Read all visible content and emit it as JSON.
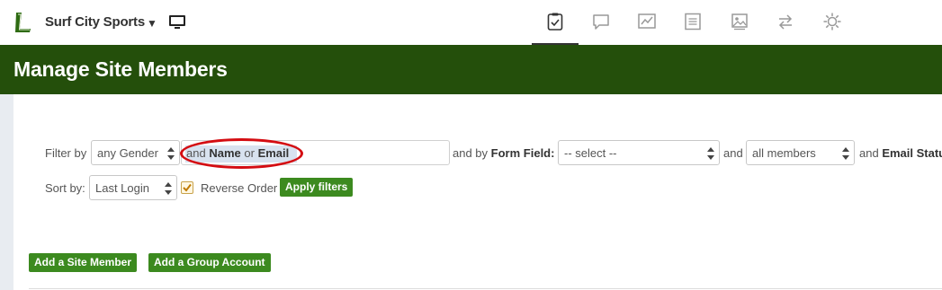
{
  "topbar": {
    "site_name": "Surf City Sports",
    "site_caret": "▼",
    "icons": [
      "logo-icon",
      "monitor-icon",
      "clipboard-check-icon",
      "chat-bubble-icon",
      "chart-line-icon",
      "document-icon",
      "image-icon",
      "swap-arrows-icon",
      "gear-icon"
    ],
    "active_nav": "clipboard-check-icon"
  },
  "header": {
    "title": "Manage Site Members",
    "bg_color": "#244f0b"
  },
  "filters": {
    "filter_by_label": "Filter by",
    "gender_value": "any Gender",
    "name_email_prefix": "and",
    "name_label": "Name",
    "name_email_or": "or",
    "email_label": "Email",
    "name_email_input_value": "",
    "form_field_prefix": "and by",
    "form_field_label": "Form Field:",
    "form_field_value": "-- select --",
    "members_prefix": "and",
    "members_value": "all members",
    "email_status_prefix": "and",
    "email_status_label": "Email Statu",
    "sort_by_label": "Sort by:",
    "sort_value": "Last Login",
    "reverse_order_label": "Reverse Order",
    "reverse_order_checked": true,
    "apply_label": "Apply filters"
  },
  "actions": {
    "add_member_label": "Add a Site Member",
    "add_group_label": "Add a Group Account"
  },
  "colors": {
    "accent_green": "#3c8a1f",
    "annotation_red": "#d40d12"
  }
}
